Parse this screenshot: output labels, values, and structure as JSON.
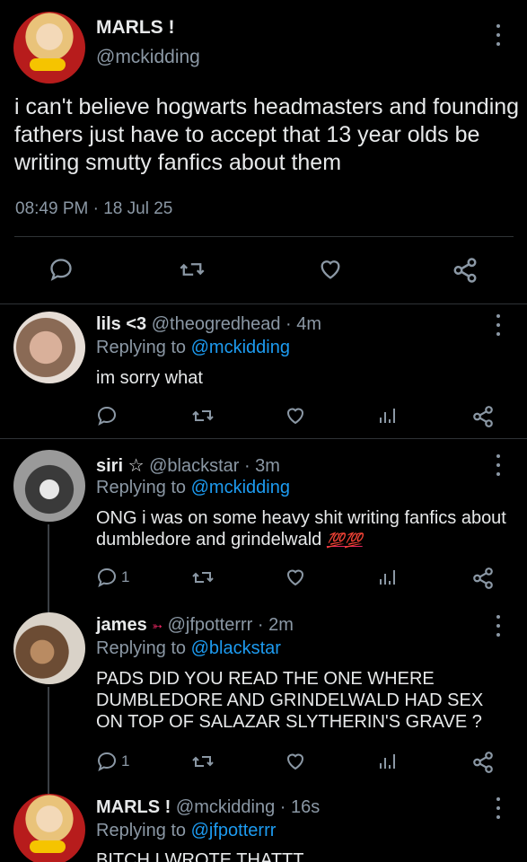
{
  "main_tweet": {
    "display_name": "MARLS !",
    "handle": "@mckidding",
    "text": "i can't believe hogwarts headmasters and founding fathers just have to accept that 13 year olds be writing smutty fanfics about them",
    "timestamp": "08:49 PM · 18 Jul 25"
  },
  "replies": [
    {
      "display_name": "lils <3",
      "meta": "@theogredhead · 4m",
      "replying_prefix": "Replying to ",
      "replying_to": "@mckidding",
      "text": "im sorry what",
      "reply_count": ""
    },
    {
      "display_name": "siri ☆",
      "meta": "@blackstar · 3m",
      "replying_prefix": "Replying to ",
      "replying_to": "@mckidding",
      "text": "ONG i was on some heavy shit writing fanfics about dumbledore and grindelwald",
      "emoji": "💯💯",
      "reply_count": "1"
    },
    {
      "display_name": "james",
      "name_emoji": "➳",
      "meta": "@jfpotterrr · 2m",
      "replying_prefix": "Replying to ",
      "replying_to": "@blackstar",
      "text": "PADS DID YOU READ THE ONE WHERE DUMBLEDORE AND GRINDELWALD HAD SEX ON TOP OF SALAZAR SLYTHERIN'S GRAVE ?",
      "reply_count": "1"
    },
    {
      "display_name": "MARLS !",
      "meta": "@mckidding · 16s",
      "replying_prefix": "Replying to ",
      "replying_to": "@jfpotterrr",
      "text": "BITCH I WROTE THATTT",
      "reply_count": ""
    }
  ],
  "colors": {
    "background": "#000000",
    "text": "#e7e9ea",
    "muted": "#8b98a5",
    "link": "#1d9bf0",
    "divider": "#2f3336"
  },
  "icons": [
    "more-icon",
    "reply-icon",
    "retweet-icon",
    "like-icon",
    "share-icon",
    "analytics-icon"
  ]
}
